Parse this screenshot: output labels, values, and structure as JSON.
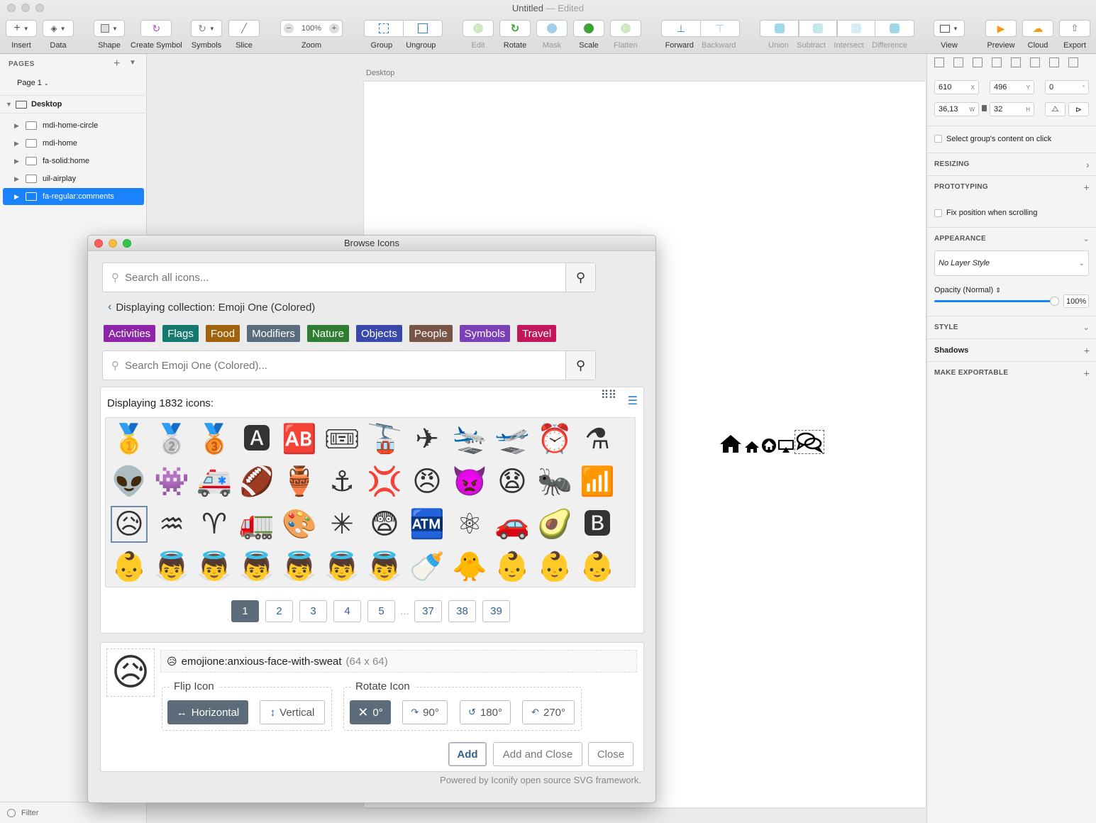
{
  "window": {
    "title": "Untitled",
    "title_suffix": "— Edited"
  },
  "toolbar": {
    "insert": "Insert",
    "data": "Data",
    "shape": "Shape",
    "create_symbol": "Create Symbol",
    "symbols": "Symbols",
    "slice": "Slice",
    "zoom_value": "100%",
    "zoom": "Zoom",
    "group": "Group",
    "ungroup": "Ungroup",
    "edit": "Edit",
    "rotate": "Rotate",
    "mask": "Mask",
    "scale": "Scale",
    "flatten": "Flatten",
    "forward": "Forward",
    "backward": "Backward",
    "union": "Union",
    "subtract": "Subtract",
    "intersect": "Intersect",
    "difference": "Difference",
    "view": "View",
    "preview": "Preview",
    "cloud": "Cloud",
    "export": "Export"
  },
  "left_panel": {
    "pages_header": "PAGES",
    "current_page": "Page 1",
    "artboard": "Desktop",
    "layers": [
      {
        "name": "mdi-home-circle"
      },
      {
        "name": "mdi-home"
      },
      {
        "name": "fa-solid:home"
      },
      {
        "name": "uil-airplay"
      },
      {
        "name": "fa-regular:comments"
      }
    ],
    "filter": "Filter"
  },
  "canvas": {
    "artboard_label": "Desktop"
  },
  "right_panel": {
    "x": "610",
    "x_unit": "X",
    "y": "496",
    "y_unit": "Y",
    "rotation": "0",
    "rotation_unit": "°",
    "w": "36,13",
    "w_unit": "W",
    "h": "32",
    "h_unit": "H",
    "select_group_content": "Select group's content on click",
    "resizing": "RESIZING",
    "prototyping": "PROTOTYPING",
    "fix_position": "Fix position when scrolling",
    "appearance": "APPEARANCE",
    "layer_style": "No Layer Style",
    "opacity_label": "Opacity (Normal)",
    "opacity_value": "100%",
    "style": "STYLE",
    "shadows": "Shadows",
    "make_exportable": "MAKE EXPORTABLE"
  },
  "dialog": {
    "title": "Browse Icons",
    "search_placeholder": "Search all icons...",
    "collection_label": "Displaying collection: Emoji One (Colored)",
    "categories": [
      {
        "label": "Activities",
        "color": "#8e24aa"
      },
      {
        "label": "Flags",
        "color": "#16796f"
      },
      {
        "label": "Food",
        "color": "#a0620b"
      },
      {
        "label": "Modifiers",
        "color": "#5a6b7b"
      },
      {
        "label": "Nature",
        "color": "#2e7d32"
      },
      {
        "label": "Objects",
        "color": "#3949ab"
      },
      {
        "label": "People",
        "color": "#795548"
      },
      {
        "label": "Symbols",
        "color": "#7b3fb8"
      },
      {
        "label": "Travel",
        "color": "#c2185b"
      }
    ],
    "collection_search_placeholder": "Search Emoji One (Colored)...",
    "display_count": "Displaying 1832 icons:",
    "icons": [
      "🥇",
      "🥈",
      "🥉",
      "🅰",
      "🆎",
      "🎟",
      "🚡",
      "✈",
      "🛬",
      "🛫",
      "⏰",
      "⚗",
      "👽",
      "👾",
      "🚑",
      "🏈",
      "🏺",
      "⚓",
      "💢",
      "😠",
      "👿",
      "😧",
      "🐜",
      "📶",
      "😥",
      "♒",
      "♈",
      "🚛",
      "🎨",
      "✳",
      "😨",
      "🏧",
      "⚛",
      "🚗",
      "🥑",
      "🅱",
      "👶",
      "👼",
      "👼",
      "👼",
      "👼",
      "👼",
      "👼",
      "🍼",
      "🐥",
      "👶",
      "👶",
      "👶"
    ],
    "pages": [
      "1",
      "2",
      "3",
      "4",
      "5",
      "…",
      "37",
      "38",
      "39"
    ],
    "selected_icon_name": "emojione:anxious-face-with-sweat",
    "selected_icon_dims": "(64 x 64)",
    "selected_icon_glyph": "😥",
    "flip_legend": "Flip Icon",
    "flip_horizontal": "Horizontal",
    "flip_vertical": "Vertical",
    "rotate_legend": "Rotate Icon",
    "rot_0": "0°",
    "rot_90": "90°",
    "rot_180": "180°",
    "rot_270": "270°",
    "add": "Add",
    "add_close": "Add and Close",
    "close": "Close",
    "powered": "Powered by Iconify open source SVG framework."
  },
  "colors": {
    "accent": "#1a82fb",
    "dialog_active": "#5c6b79",
    "pager_text": "#34618e"
  }
}
